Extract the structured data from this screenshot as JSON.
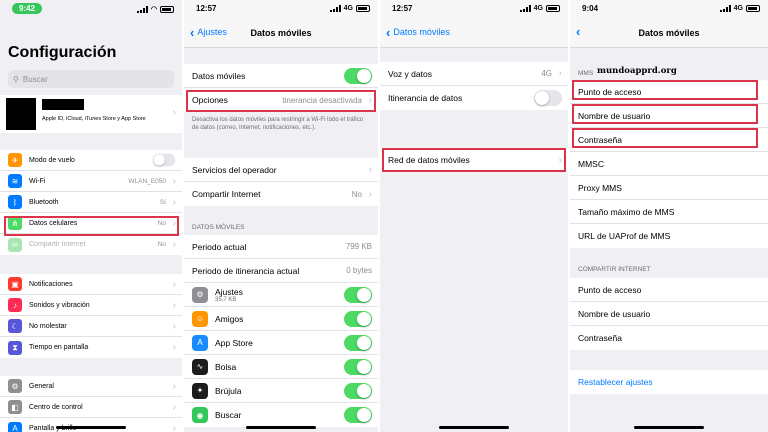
{
  "p1": {
    "time": "9:42",
    "title": "Configuración",
    "search_placeholder": "Buscar",
    "account_sub": "Apple ID, iCloud, iTunes Store y App Store",
    "rows_a": [
      {
        "label": "Modo de vuelo",
        "value": "",
        "icon": "airplane-icon",
        "color": "#ff9500"
      },
      {
        "label": "Wi-Fi",
        "value": "WLAN_E050",
        "icon": "wifi-icon",
        "color": "#007aff"
      },
      {
        "label": "Bluetooth",
        "value": "Sí",
        "icon": "bluetooth-icon",
        "color": "#007aff"
      },
      {
        "label": "Datos celulares",
        "value": "No",
        "icon": "cellular-icon",
        "color": "#4cd964"
      },
      {
        "label": "Compartir Internet",
        "value": "No",
        "icon": "hotspot-icon",
        "color": "#4cd964"
      }
    ],
    "rows_b": [
      {
        "label": "Notificaciones",
        "icon": "notifications-icon",
        "color": "#ff3b30"
      },
      {
        "label": "Sonidos y vibración",
        "icon": "sound-icon",
        "color": "#ff2d55"
      },
      {
        "label": "No molestar",
        "icon": "moon-icon",
        "color": "#5856d6"
      },
      {
        "label": "Tiempo en pantalla",
        "icon": "hourglass-icon",
        "color": "#5856d6"
      }
    ],
    "rows_c": [
      {
        "label": "General",
        "icon": "gear-icon",
        "color": "#8e8e93"
      },
      {
        "label": "Centro de control",
        "icon": "control-center-icon",
        "color": "#8e8e93"
      },
      {
        "label": "Pantalla y brillo",
        "icon": "brightness-icon",
        "color": "#007aff"
      }
    ]
  },
  "p2": {
    "time": "12:57",
    "network": "4G",
    "back": "Ajustes",
    "title": "Datos móviles",
    "row_datos": "Datos móviles",
    "row_opciones": "Opciones",
    "row_opciones_value": "tinerancia desactivada",
    "note": "Desactiva los datos móviles para restringir a Wi-Fi todo el tráfico de datos (correo, Internet, notificaciones, etc.).",
    "row_servicios": "Servicios del operador",
    "row_compartir": "Compartir Internet",
    "row_compartir_value": "No",
    "section": "DATOS MÓVILES",
    "periodo_actual": "Periodo actual",
    "periodo_actual_value": "799 KB",
    "periodo_itin": "Periodo de itinerancia actual",
    "periodo_itin_value": "0 bytes",
    "apps": [
      {
        "label": "Ajustes",
        "sub": "35,7 KB",
        "icon": "settings-app-icon",
        "color": "#8e8e93"
      },
      {
        "label": "Amigos",
        "sub": "",
        "icon": "friends-app-icon",
        "color": "#ff9500"
      },
      {
        "label": "App Store",
        "sub": "",
        "icon": "app-store-icon",
        "color": "#1a8cff"
      },
      {
        "label": "Bolsa",
        "sub": "",
        "icon": "stocks-app-icon",
        "color": "#1c1c1e"
      },
      {
        "label": "Brújula",
        "sub": "",
        "icon": "compass-app-icon",
        "color": "#1c1c1e"
      },
      {
        "label": "Buscar",
        "sub": "",
        "icon": "find-app-icon",
        "color": "#34c759"
      }
    ]
  },
  "p3": {
    "time": "12:57",
    "network": "4G",
    "back": "Datos móviles",
    "row_voz": "Voz y datos",
    "row_voz_value": "4G",
    "row_itin": "Itinerancia de datos",
    "row_red": "Red de datos móviles"
  },
  "p4": {
    "time": "9:04",
    "network": "4G",
    "title": "Datos móviles",
    "section_mms": "MMS",
    "watermark": "mundoapprd.org",
    "mms_rows": [
      "Punto de acceso",
      "Nombre de usuario",
      "Contraseña",
      "MMSC",
      "Proxy MMS",
      "Tamaño máximo de MMS",
      "URL de UAProf de MMS"
    ],
    "section_share": "COMPARTIR INTERNET",
    "share_rows": [
      "Punto de acceso",
      "Nombre de usuario",
      "Contraseña"
    ],
    "reset": "Restablecer ajustes"
  }
}
